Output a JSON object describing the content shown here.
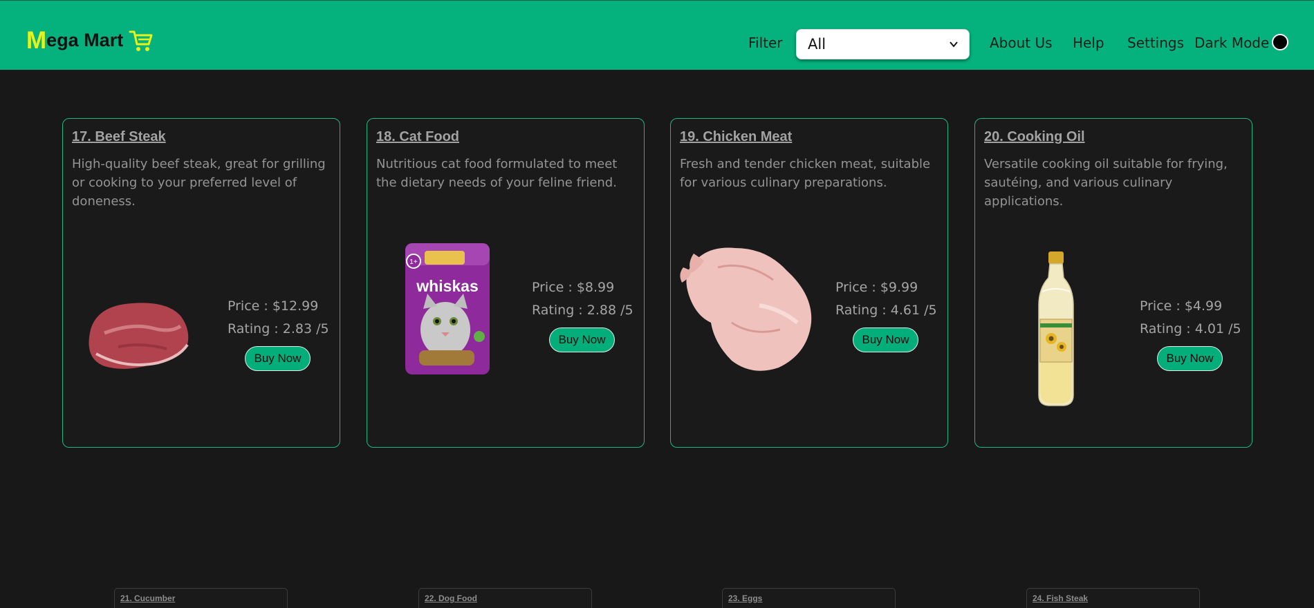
{
  "header": {
    "logo_first_letter": "M",
    "logo_rest": "ega Mart",
    "filter_label": "Filter",
    "filter_selected": "All",
    "nav": [
      "About Us",
      "Help",
      "Settings"
    ],
    "dark_mode_label": "Dark Mode"
  },
  "colors": {
    "accent": "#05b27e",
    "logo_accent": "#e6f21a",
    "page_background": "#181818"
  },
  "products": [
    {
      "title": "17. Beef Steak",
      "description": "High-quality beef steak, great for grilling or cooking to your preferred level of doneness.",
      "price": "Price : $12.99",
      "rating": "Rating : 2.83 /5",
      "buy_label": "Buy Now",
      "image": "beef-steak-image"
    },
    {
      "title": "18. Cat Food",
      "description": "Nutritious cat food formulated to meet the dietary needs of your feline friend.",
      "price": "Price : $8.99",
      "rating": "Rating : 2.88 /5",
      "buy_label": "Buy Now",
      "image": "cat-food-image",
      "image_brand": "whiskas",
      "image_badge": "1+"
    },
    {
      "title": "19. Chicken Meat",
      "description": "Fresh and tender chicken meat, suitable for various culinary preparations.",
      "price": "Price : $9.99",
      "rating": "Rating : 4.61 /5",
      "buy_label": "Buy Now",
      "image": "chicken-meat-image"
    },
    {
      "title": "20. Cooking Oil",
      "description": "Versatile cooking oil suitable for frying, sautéing, and various culinary applications.",
      "price": "Price : $4.99",
      "rating": "Rating : 4.01 /5",
      "buy_label": "Buy Now",
      "image": "cooking-oil-image"
    }
  ],
  "next_row": [
    "21. Cucumber",
    "22. Dog Food",
    "23. Eggs",
    "24. Fish Steak"
  ]
}
